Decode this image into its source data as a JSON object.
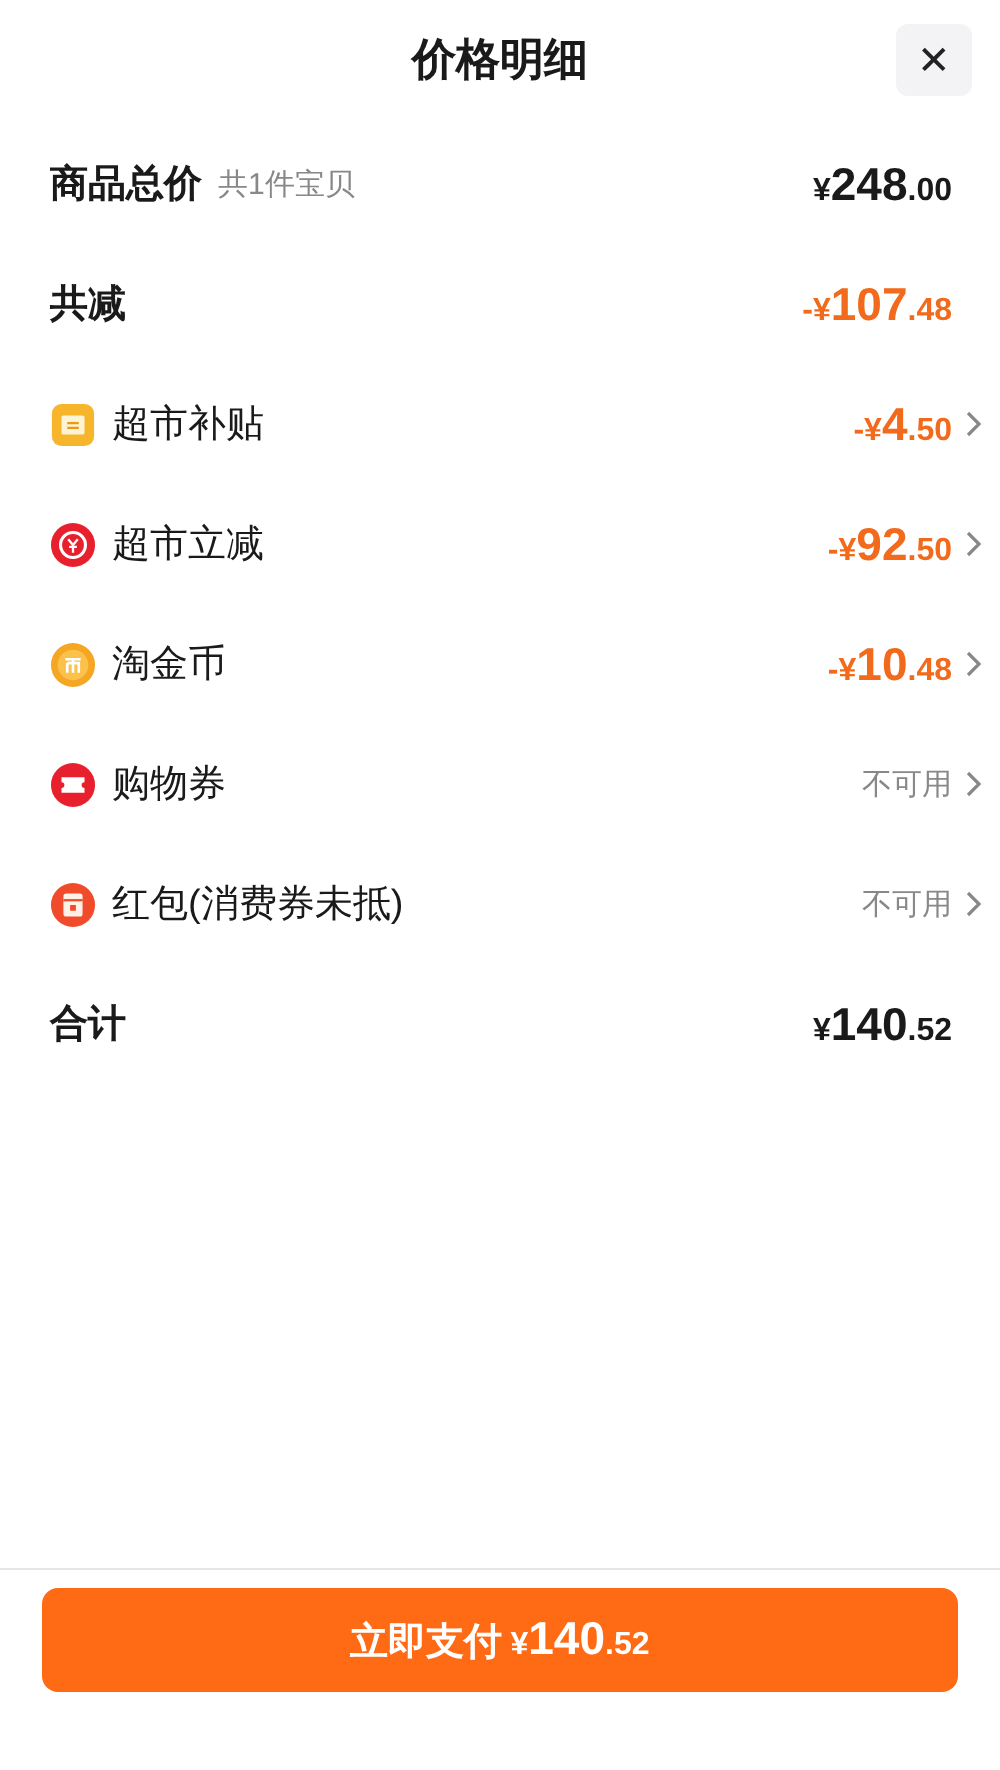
{
  "header": {
    "title": "价格明细",
    "close": "✕"
  },
  "rows": [
    {
      "kind": "total",
      "label": "商品总价",
      "note": "共1件宝贝",
      "amount": {
        "prefix": "¥",
        "integer": "248",
        "decimal": ".00"
      }
    },
    {
      "kind": "discount",
      "label": "共减",
      "amount": {
        "prefix": "-¥",
        "integer": "107",
        "decimal": ".48"
      }
    },
    {
      "kind": "item",
      "label": "超市补贴",
      "amount": {
        "prefix": "-¥",
        "integer": "4",
        "decimal": ".50"
      }
    },
    {
      "kind": "item",
      "label": "超市立减",
      "amount": {
        "prefix": "-¥",
        "integer": "92",
        "decimal": ".50"
      }
    },
    {
      "kind": "item",
      "label": "淘金币",
      "amount": {
        "prefix": "-¥",
        "integer": "10",
        "decimal": ".48"
      }
    },
    {
      "kind": "unavailable",
      "label": "购物券",
      "status": "不可用"
    },
    {
      "kind": "unavailable",
      "label": "红包(消费券未抵)",
      "status": "不可用"
    },
    {
      "kind": "total",
      "label": "合计",
      "amount": {
        "prefix": "¥",
        "integer": "140",
        "decimal": ".52"
      }
    }
  ],
  "pay_button": {
    "label": "立即支付",
    "amount": {
      "prefix": "¥",
      "integer": "140",
      "decimal": ".52"
    }
  }
}
